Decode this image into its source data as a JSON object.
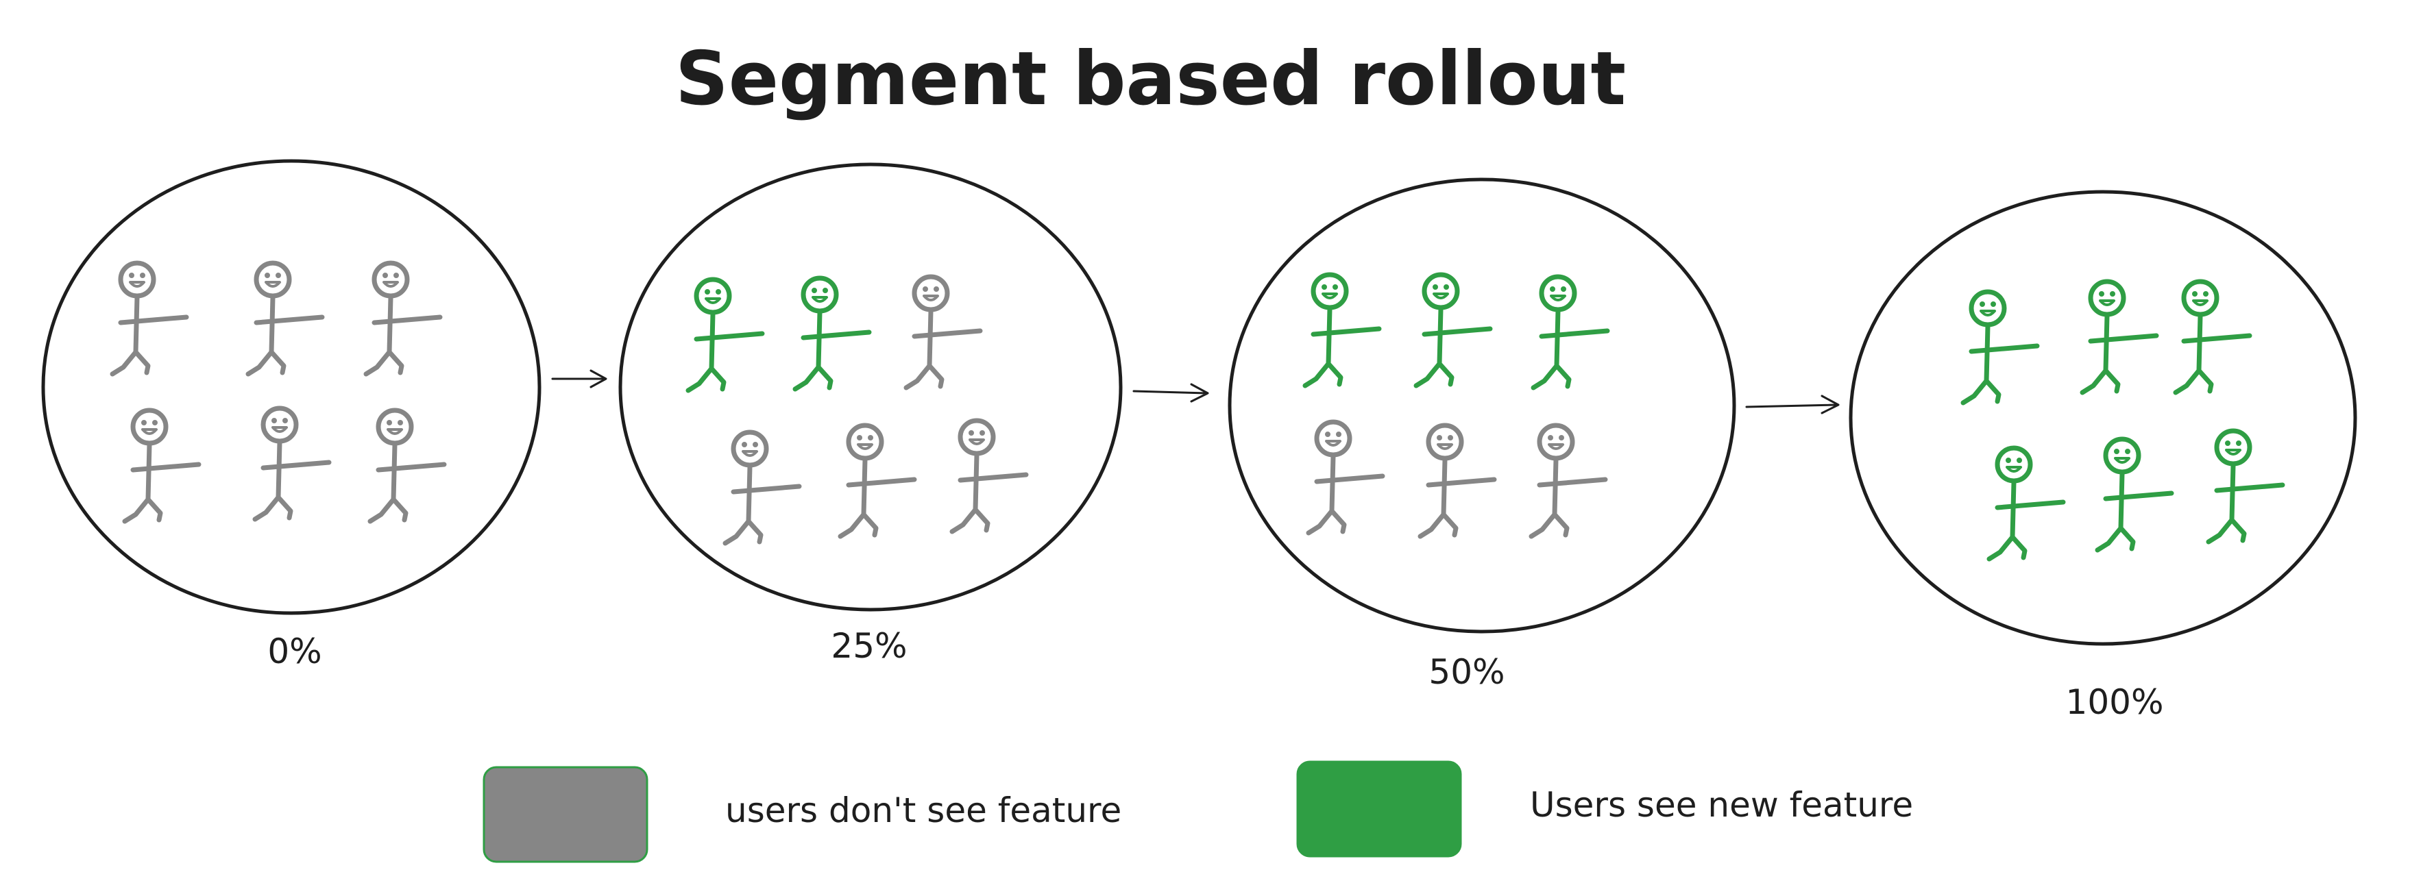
{
  "title": "Segment based rollout",
  "colors": {
    "sees_feature": "#2f9e44",
    "no_feature": "#868686",
    "ink": "#1e1e1e"
  },
  "segments": [
    {
      "percent_label": "0%",
      "rollout_fraction": 0.0,
      "green_count": 0,
      "total_count": 6
    },
    {
      "percent_label": "25%",
      "rollout_fraction": 0.25,
      "green_count": 2,
      "total_count": 6
    },
    {
      "percent_label": "50%",
      "rollout_fraction": 0.5,
      "green_count": 3,
      "total_count": 6
    },
    {
      "percent_label": "100%",
      "rollout_fraction": 1.0,
      "green_count": 6,
      "total_count": 6
    }
  ],
  "legend": {
    "no_feature_label": "users don't see feature",
    "sees_feature_label": "Users see new feature"
  }
}
